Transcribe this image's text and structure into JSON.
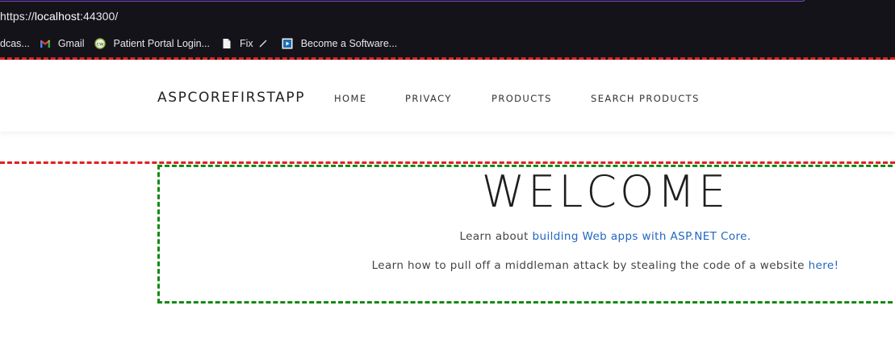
{
  "browser": {
    "url_prefix": "https://",
    "url_host": "localhost",
    "url_rest": ":44300/",
    "bookmarks": [
      {
        "label": "dcas...",
        "icon": "podcast-icon"
      },
      {
        "label": "Gmail",
        "icon": "gmail-icon"
      },
      {
        "label": "Patient Portal Login...",
        "icon": "portal-icon"
      },
      {
        "label": "Fix",
        "icon": "document-icon"
      },
      {
        "label": "Become a Software...",
        "icon": "video-icon"
      }
    ]
  },
  "navbar": {
    "brand": "ASPCOREFIRSTAPP",
    "links": [
      "HOME",
      "PRIVACY",
      "PRODUCTS",
      "SEARCH PRODUCTS"
    ]
  },
  "main": {
    "heading": "WELCOME",
    "learn_prefix": "Learn about ",
    "learn_link": "building Web apps with ASP.NET Core",
    "learn_suffix": ".",
    "middleman_prefix": "Learn how to pull off a middleman attack by stealing the code of a website ",
    "middleman_link": "here!"
  },
  "colors": {
    "chrome_bg": "#15131a",
    "link": "#2367c0",
    "outline_red": "#e02020",
    "outline_green": "#138a13"
  }
}
